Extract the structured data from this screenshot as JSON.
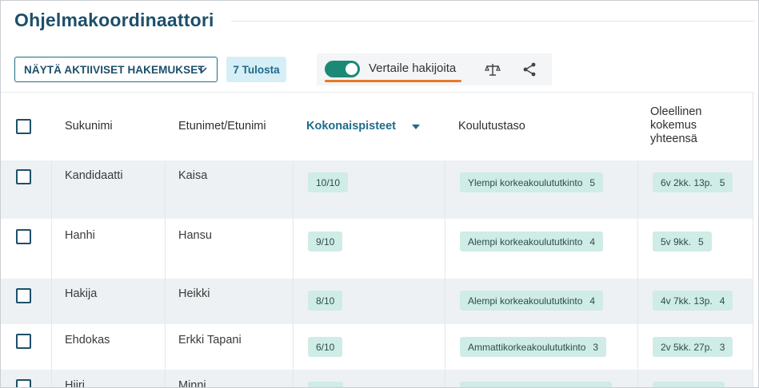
{
  "page": {
    "title": "Ohjelmakoordinaattori"
  },
  "toolbar": {
    "dropdown_label": "NÄYTÄ AKTIIVISET HAKEMUKSET",
    "results_badge": "7 Tulosta",
    "compare_label": "Vertaile hakijoita",
    "compare_enabled": true,
    "colors": {
      "toggle_on": "#1a8a76",
      "underline": "#e8792a",
      "primary": "#1d4f6b"
    },
    "icons": [
      "chevron-down-icon",
      "scale-icon",
      "share-icon"
    ]
  },
  "table": {
    "columns": [
      {
        "key": "select",
        "label": ""
      },
      {
        "key": "sukunimi",
        "label": "Sukunimi"
      },
      {
        "key": "etunimet",
        "label": "Etunimet/Etunimi"
      },
      {
        "key": "kokonaispisteet",
        "label": "Kokonaispisteet",
        "sorted": "desc"
      },
      {
        "key": "koulutustaso",
        "label": "Koulutustaso"
      },
      {
        "key": "kokemus",
        "label": "Oleellinen kokemus yhteensä"
      }
    ],
    "rows": [
      {
        "sukunimi": "Kandidaatti",
        "etunimet": "Kaisa",
        "pisteet": "10/10",
        "koulutus": "Ylempi korkeakoulututkinto",
        "koulutus_n": "5",
        "kokemus": "6v 2kk. 13p.",
        "kokemus_n": "5"
      },
      {
        "sukunimi": "Hanhi",
        "etunimet": "Hansu",
        "pisteet": "9/10",
        "koulutus": "Alempi korkeakoulututkinto",
        "koulutus_n": "4",
        "kokemus": "5v 9kk.",
        "kokemus_n": "5"
      },
      {
        "sukunimi": "Hakija",
        "etunimet": "Heikki",
        "pisteet": "8/10",
        "koulutus": "Alempi korkeakoulututkinto",
        "koulutus_n": "4",
        "kokemus": "4v 7kk. 13p.",
        "kokemus_n": "4"
      },
      {
        "sukunimi": "Ehdokas",
        "etunimet": "Erkki Tapani",
        "pisteet": "6/10",
        "koulutus": "Ammattikorkeakoulututkinto",
        "koulutus_n": "3",
        "kokemus": "2v 5kk. 27p.",
        "kokemus_n": "3"
      },
      {
        "sukunimi": "Hiiri",
        "etunimet": "Minni",
        "pisteet": "",
        "koulutus": "",
        "koulutus_n": "",
        "kokemus": "",
        "kokemus_n": ""
      }
    ]
  }
}
